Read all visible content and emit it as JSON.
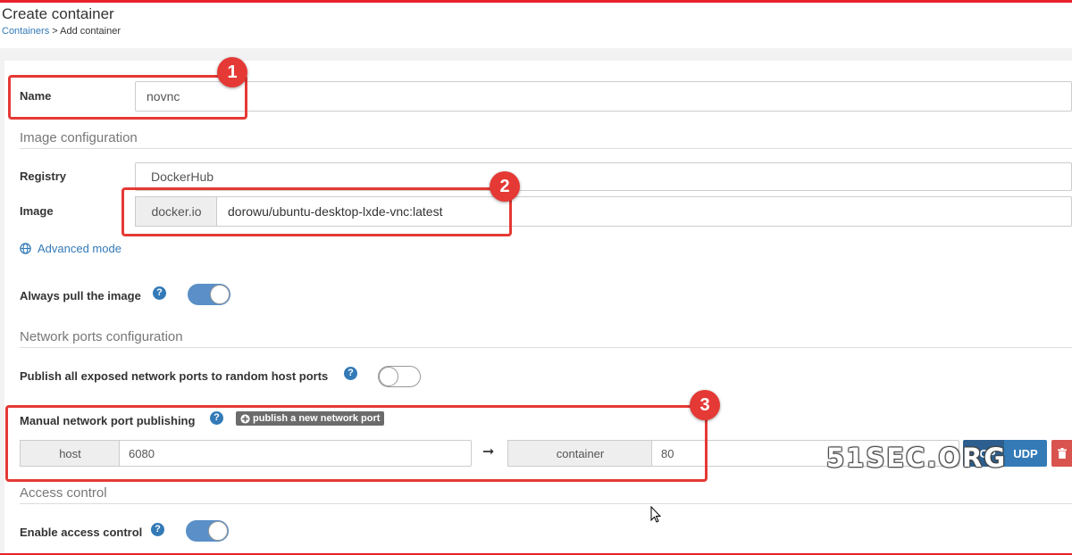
{
  "page": {
    "title": "Create container"
  },
  "breadcrumb": {
    "link": "Containers",
    "separator": " > ",
    "current": "Add container"
  },
  "form": {
    "name_label": "Name",
    "name_value": "novnc",
    "image_section": "Image configuration",
    "registry_label": "Registry",
    "registry_value": "DockerHub",
    "image_label": "Image",
    "image_prefix": "docker.io",
    "image_value": "dorowu/ubuntu-desktop-lxde-vnc:latest",
    "advanced_mode": "Advanced mode",
    "always_pull_label": "Always pull the image",
    "always_pull_on": true,
    "network_section": "Network ports configuration",
    "publish_all_label": "Publish all exposed network ports to random host ports",
    "publish_all_on": false,
    "manual_publish_label": "Manual network port publishing",
    "publish_new_button": "publish a new network port",
    "port": {
      "host_addon": "host",
      "host_value": "6080",
      "container_addon": "container",
      "container_value": "80",
      "tcp_label": "TCP",
      "udp_label": "UDP"
    },
    "access_section": "Access control",
    "access_label": "Enable access control",
    "access_on": true
  },
  "annotations": [
    "1",
    "2",
    "3"
  ],
  "watermark": "51SEC.ORG",
  "colors": {
    "accent": "#337ab7",
    "highlight": "#e53935",
    "toggle_on": "#5b8fc7",
    "danger": "#d9534f"
  }
}
